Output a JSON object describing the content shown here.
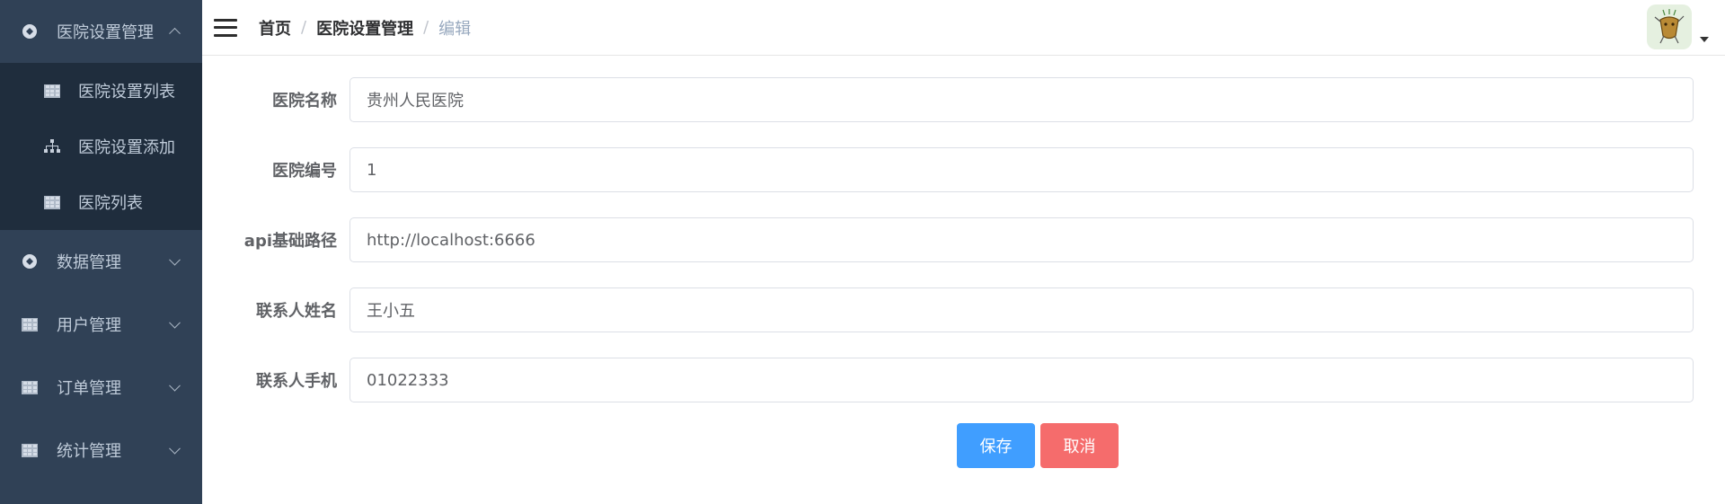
{
  "sidebar": {
    "groups": [
      {
        "label": "医院设置管理",
        "icon": "settings-icon",
        "expanded": true,
        "items": [
          {
            "label": "医院设置列表",
            "icon": "table-icon"
          },
          {
            "label": "医院设置添加",
            "icon": "tree-icon"
          },
          {
            "label": "医院列表",
            "icon": "table-icon"
          }
        ]
      },
      {
        "label": "数据管理",
        "icon": "settings-icon"
      },
      {
        "label": "用户管理",
        "icon": "table-icon"
      },
      {
        "label": "订单管理",
        "icon": "table-icon"
      },
      {
        "label": "统计管理",
        "icon": "table-icon"
      }
    ]
  },
  "navbar": {
    "breadcrumb": [
      "首页",
      "医院设置管理",
      "编辑"
    ]
  },
  "form": {
    "fields": [
      {
        "label": "医院名称",
        "value": "贵州人民医院"
      },
      {
        "label": "医院编号",
        "value": "1"
      },
      {
        "label": "api基础路径",
        "value": "http://localhost:6666"
      },
      {
        "label": "联系人姓名",
        "value": "王小五"
      },
      {
        "label": "联系人手机",
        "value": "01022333"
      }
    ],
    "save_label": "保存",
    "cancel_label": "取消"
  },
  "colors": {
    "sidebar_bg": "#304156",
    "submenu_bg": "#1f2d3d",
    "primary": "#409eff",
    "danger": "#f56c6c"
  }
}
